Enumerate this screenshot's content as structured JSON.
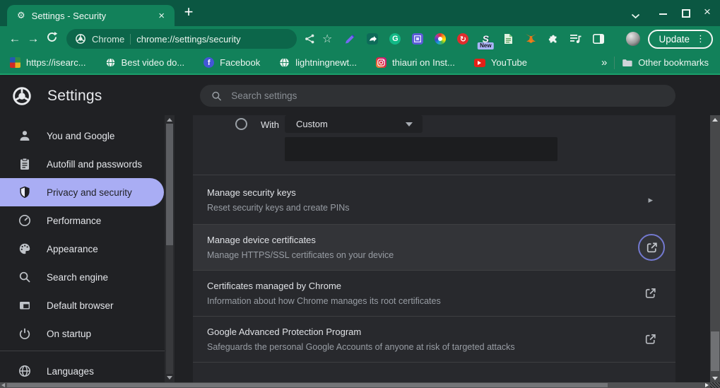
{
  "colors": {
    "frame_green": "#0b5742",
    "toolbar_green": "#12815a",
    "accent_green_line": "#1ba26c",
    "url_pill_green": "#0c664a",
    "dark_bg": "#202124",
    "card_bg": "#28292d",
    "row_hover_bg": "#333438",
    "selected_nav_bg": "#a9adf4",
    "focus_ring_blue": "#7379cf",
    "new_badge_bg": "#aab4f8"
  },
  "window": {
    "tab_title": "Settings - Security"
  },
  "toolbar": {
    "site_label": "Chrome",
    "url": "chrome://settings/security",
    "update_label": "Update",
    "extensions": [
      {
        "name": "pen-tool"
      },
      {
        "name": "video-save"
      },
      {
        "name": "grammarly",
        "glyph": "G"
      },
      {
        "name": "photo-frame"
      },
      {
        "name": "color-wheel"
      },
      {
        "name": "red-sync",
        "glyph": "↻"
      },
      {
        "name": "s-logo",
        "glyph": "S",
        "badge": "New"
      },
      {
        "name": "green-document"
      },
      {
        "name": "metamask-fox"
      },
      {
        "name": "puzzle"
      },
      {
        "name": "media-playlist"
      },
      {
        "name": "side-panel"
      }
    ]
  },
  "bookmarks": {
    "items": [
      {
        "label": "https://isearc...",
        "icon": "mosaic-favicon"
      },
      {
        "label": "Best video do...",
        "icon": "globe-favicon"
      },
      {
        "label": "Facebook",
        "icon": "facebook-favicon",
        "glyph": "f"
      },
      {
        "label": "lightningnewt...",
        "icon": "globe-favicon"
      },
      {
        "label": "thiauri on Inst...",
        "icon": "instagram-favicon"
      },
      {
        "label": "YouTube",
        "icon": "youtube-favicon"
      }
    ],
    "overflow": "»",
    "other_bookmarks": "Other bookmarks"
  },
  "header": {
    "title": "Settings",
    "search_placeholder": "Search settings"
  },
  "sidebar": {
    "items": [
      {
        "label": "You and Google",
        "icon": "person"
      },
      {
        "label": "Autofill and passwords",
        "icon": "clipboard"
      },
      {
        "label": "Privacy and security",
        "icon": "shield",
        "selected": true
      },
      {
        "label": "Performance",
        "icon": "speedometer"
      },
      {
        "label": "Appearance",
        "icon": "palette"
      },
      {
        "label": "Search engine",
        "icon": "magnifier"
      },
      {
        "label": "Default browser",
        "icon": "browser-window"
      },
      {
        "label": "On startup",
        "icon": "power"
      },
      {
        "label": "Languages",
        "icon": "globe"
      }
    ]
  },
  "content": {
    "with_row": {
      "label": "With",
      "select_value": "Custom"
    },
    "rows": [
      {
        "title": "Manage security keys",
        "subtitle": "Reset security keys and create PINs",
        "trailing": "chevron"
      },
      {
        "title": "Manage device certificates",
        "subtitle": "Manage HTTPS/SSL certificates on your device",
        "trailing": "external-link",
        "highlighted": true
      },
      {
        "title": "Certificates managed by Chrome",
        "subtitle": "Information about how Chrome manages its root certificates",
        "trailing": "external-link"
      },
      {
        "title": "Google Advanced Protection Program",
        "subtitle": "Safeguards the personal Google Accounts of anyone at risk of targeted attacks",
        "trailing": "external-link"
      }
    ]
  }
}
